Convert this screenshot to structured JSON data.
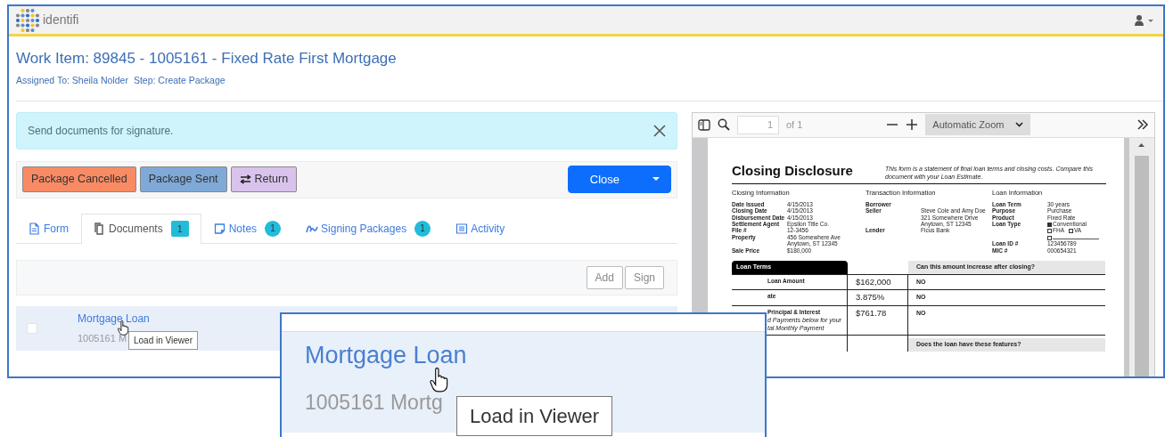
{
  "header": {
    "logo_text": "identifi"
  },
  "work_item": {
    "title": "Work Item: 89845 - 1005161 - Fixed Rate First Mortgage",
    "assigned": "Assigned To: Sheila Nolder",
    "step": "Step: Create Package"
  },
  "alert": {
    "message": "Send documents for signature."
  },
  "actions": [
    {
      "label": "Package Cancelled",
      "kind": "plain",
      "color": "#f98b64"
    },
    {
      "label": "Package Sent",
      "kind": "plain",
      "color": "#7fa9d6"
    },
    {
      "label": "Return",
      "kind": "return",
      "color": "#d9c3ec"
    }
  ],
  "close_button": {
    "label": "Close"
  },
  "tabs": [
    {
      "label": "Form",
      "kind": "form",
      "selected": false
    },
    {
      "label": "Documents",
      "kind": "documents",
      "badge": "1",
      "selected": true
    },
    {
      "label": "Notes",
      "kind": "notes",
      "badge": "1",
      "selected": false
    },
    {
      "label": "Signing Packages",
      "kind": "signing",
      "badge": "1",
      "selected": false
    },
    {
      "label": "Activity",
      "kind": "activity",
      "selected": false
    }
  ],
  "documents_toolbar": {
    "buttons": [
      "Add",
      "Sign"
    ]
  },
  "documents": [
    {
      "title": "Mortgage Loan",
      "subtitle": "1005161 M",
      "checked": false,
      "tooltip": "Load in Viewer"
    }
  ],
  "viewer": {
    "page": "1",
    "page_count": "of 1",
    "zoom": "Automatic Zoom",
    "document": {
      "title": "Closing Disclosure",
      "note": "This form is a statement of final loan terms and closing costs. Compare this document with your Loan Estimate.",
      "sections": [
        {
          "heading": "Closing Information",
          "rows": [
            {
              "label": "Date Issued",
              "value": [
                "4/15/2013"
              ]
            },
            {
              "label": "Closing Date",
              "value": [
                "4/15/2013"
              ]
            },
            {
              "label": "Disbursement Date",
              "value": [
                "4/15/2013"
              ]
            },
            {
              "label": "Settlement Agent",
              "value": [
                "Epsilon Title Co."
              ]
            },
            {
              "label": "File #",
              "value": [
                "12-3456"
              ]
            },
            {
              "label": "Property",
              "value": [
                "456 Somewhere Ave",
                "Anytown, ST 12345"
              ]
            },
            {
              "label": "Sale Price",
              "value": [
                "$180,000"
              ]
            }
          ]
        },
        {
          "heading": "Transaction Information",
          "rows": [
            {
              "label": "Borrower",
              "value": []
            },
            {
              "label": "Seller",
              "value": [
                "Steve Cole and Amy Doe",
                "321 Somewhere Drive",
                "Anytown, ST 12345"
              ]
            },
            {
              "label": "Lender",
              "value": [
                "Ficus Bank"
              ]
            }
          ]
        },
        {
          "heading": "Loan Information",
          "rows": [
            {
              "label": "Loan Term",
              "value": [
                "30 years"
              ]
            },
            {
              "label": "Purpose",
              "value": [
                "Purchase"
              ]
            },
            {
              "label": "Product",
              "value": [
                "Fixed Rate"
              ]
            },
            {
              "label": "Loan Type",
              "options": [
                {
                  "label": "Conventional",
                  "checked": true
                },
                {
                  "label": "FHA",
                  "checked": false
                },
                {
                  "label": "VA",
                  "checked": false
                },
                {
                  "checked": false
                }
              ]
            },
            {
              "label": "Loan ID #",
              "value": [
                "123456789"
              ]
            },
            {
              "label": "MIC #",
              "value": [
                "000654321"
              ]
            }
          ]
        }
      ],
      "loan_terms": {
        "heading": "Loan Terms",
        "question": "Can this amount increase after closing?",
        "rows": [
          {
            "label": "Loan Amount",
            "amount": "$162,000",
            "answer": "NO"
          },
          {
            "label": "ate",
            "amount": "3.875%",
            "answer": "NO"
          },
          {
            "label": "Principal & Interest",
            "note": [
              "d Payments below for your",
              "tal Monthly Payment"
            ],
            "amount": "$761.78",
            "answer": "NO"
          }
        ],
        "question_2": "Does the loan have these features?"
      }
    }
  },
  "magnifier": {
    "title": "Mortgage Loan",
    "subtitle": "1005161 Mortg",
    "tooltip": "Load in Viewer"
  }
}
